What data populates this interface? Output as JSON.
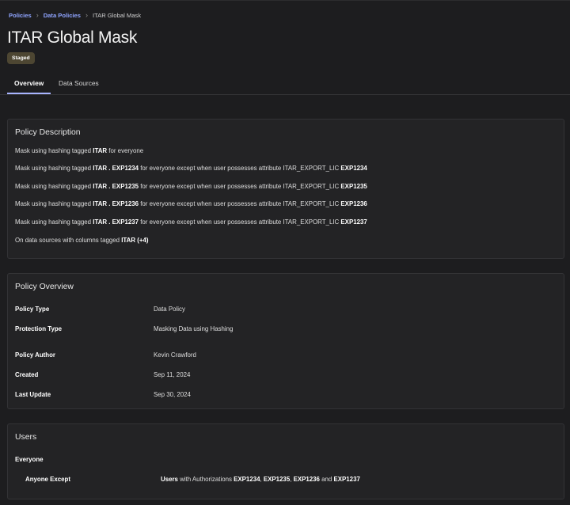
{
  "breadcrumb": {
    "items": [
      "Policies",
      "Data Policies"
    ],
    "current": "ITAR Global Mask"
  },
  "page": {
    "title": "ITAR Global Mask",
    "status": "Staged"
  },
  "tabs": [
    {
      "label": "Overview",
      "active": true
    },
    {
      "label": "Data Sources",
      "active": false
    }
  ],
  "description": {
    "title": "Policy Description",
    "line1": {
      "pre": "Mask using hashing tagged ",
      "tag": "ITAR",
      "post": " for everyone"
    },
    "rules": [
      {
        "pre": "Mask using hashing tagged ",
        "tag": "ITAR . EXP1234",
        "mid": " for everyone except when user possesses attribute ITAR_EXPORT_LIC ",
        "attr": "EXP1234"
      },
      {
        "pre": "Mask using hashing tagged ",
        "tag": "ITAR . EXP1235",
        "mid": " for everyone except when user possesses attribute ITAR_EXPORT_LIC ",
        "attr": "EXP1235"
      },
      {
        "pre": "Mask using hashing tagged ",
        "tag": "ITAR . EXP1236",
        "mid": " for everyone except when user possesses attribute ITAR_EXPORT_LIC ",
        "attr": "EXP1236"
      },
      {
        "pre": "Mask using hashing tagged ",
        "tag": "ITAR . EXP1237",
        "mid": " for everyone except when user possesses attribute ITAR_EXPORT_LIC ",
        "attr": "EXP1237"
      }
    ],
    "sources": {
      "pre": "On data sources with columns tagged ",
      "tag": "ITAR",
      "more": "(+4)"
    }
  },
  "overview": {
    "title": "Policy Overview",
    "rows": [
      {
        "label": "Policy Type",
        "value": "Data Policy"
      },
      {
        "label": "Protection Type",
        "value": "Masking Data using Hashing"
      },
      {
        "label": "Policy Author",
        "value": "Kevin Crawford"
      },
      {
        "label": "Created",
        "value": "Sep 11, 2024"
      },
      {
        "label": "Last Update",
        "value": "Sep 30, 2024"
      }
    ]
  },
  "users": {
    "title": "Users",
    "everyone": "Everyone",
    "except_label": "Anyone Except",
    "rule": {
      "subject": "Users",
      "text": " with Authorizations ",
      "a1": "EXP1234",
      "s1": ", ",
      "a2": "EXP1235",
      "s2": ", ",
      "a3": "EXP1236",
      "s3": " and ",
      "a4": "EXP1237"
    }
  },
  "colors": {
    "background": "#1d1d1f",
    "card": "#232325",
    "accent": "#a8b4ff",
    "link": "#8fa4ff",
    "badge": "#4d4632"
  }
}
